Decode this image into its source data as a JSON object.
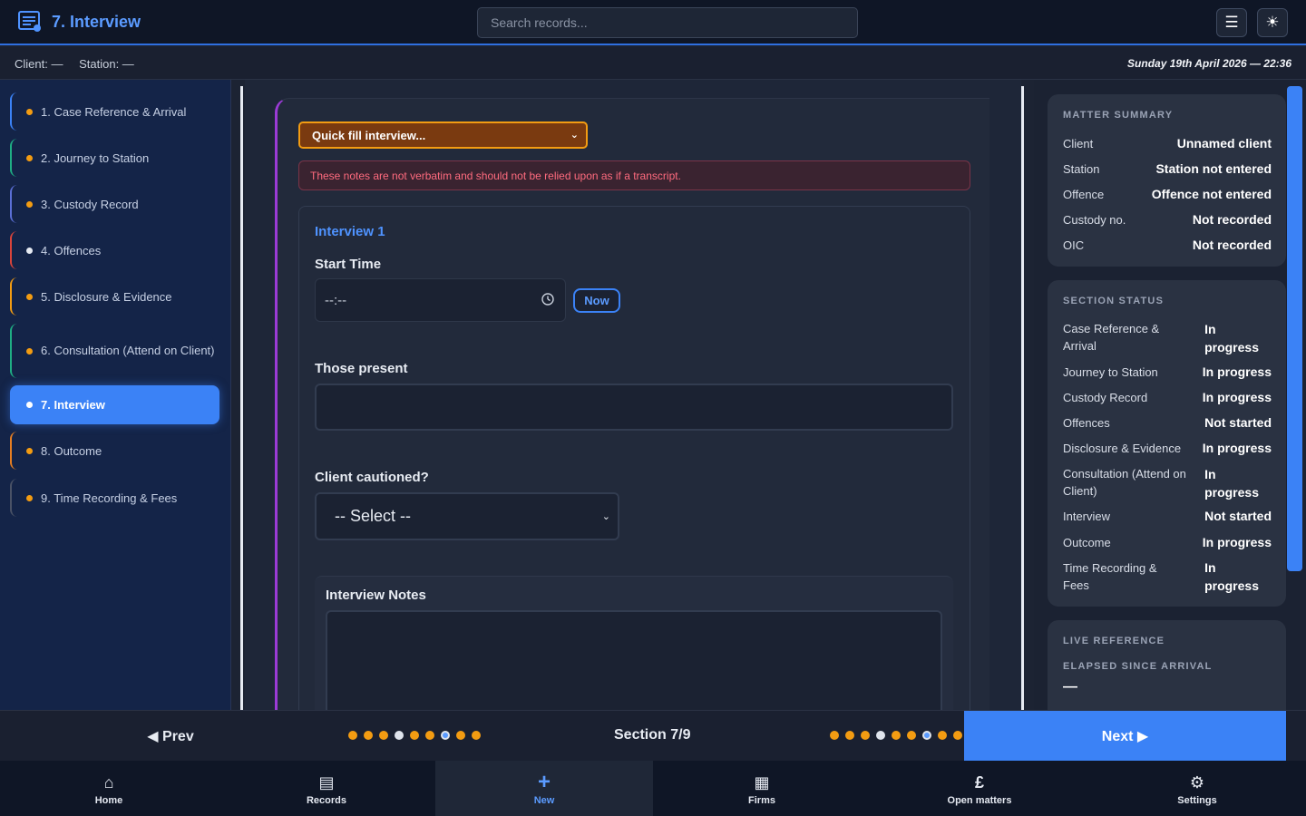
{
  "header": {
    "title": "7. Interview",
    "search_placeholder": "Search records...",
    "menu_icon": "hamburger-icon",
    "theme_icon": "sun-icon"
  },
  "subbar": {
    "client": "Client: —",
    "station": "Station: —",
    "datetime": "Sunday 19th April 2026 — 22:36"
  },
  "nav": {
    "items": [
      {
        "label": "1. Case Reference & Arrival",
        "status": "in-progress"
      },
      {
        "label": "2. Journey to Station",
        "status": "in-progress"
      },
      {
        "label": "3. Custody Record",
        "status": "in-progress"
      },
      {
        "label": "4. Offences",
        "status": "not-started"
      },
      {
        "label": "5. Disclosure & Evidence",
        "status": "in-progress"
      },
      {
        "label": "6. Consultation (Attend on Client)",
        "status": "in-progress"
      },
      {
        "label": "7. Interview",
        "status": "active"
      },
      {
        "label": "8. Outcome",
        "status": "in-progress"
      },
      {
        "label": "9. Time Recording & Fees",
        "status": "in-progress"
      }
    ]
  },
  "form": {
    "quickfill_label": "Quick fill interview...",
    "warning": "These notes are not verbatim and should not be relied upon as if a transcript.",
    "interview_heading": "Interview 1",
    "start_time_label": "Start Time",
    "start_time_value": "--:--",
    "now_button": "Now",
    "those_present_label": "Those present",
    "cautioned_label": "Client cautioned?",
    "cautioned_value": "-- Select --",
    "notes_label": "Interview Notes"
  },
  "summary": {
    "heading": "MATTER SUMMARY",
    "rows": [
      {
        "key": "Client",
        "value": "Unnamed client"
      },
      {
        "key": "Station",
        "value": "Station not entered"
      },
      {
        "key": "Offence",
        "value": "Offence not entered"
      },
      {
        "key": "Custody no.",
        "value": "Not recorded"
      },
      {
        "key": "OIC",
        "value": "Not recorded"
      }
    ]
  },
  "section_status": {
    "heading": "SECTION STATUS",
    "rows": [
      {
        "key1": "Case Reference &",
        "key2": "Arrival",
        "v1": "In",
        "v2": "progress"
      },
      {
        "key1": "Journey to Station",
        "v1": "In progress"
      },
      {
        "key1": "Custody Record",
        "v1": "In progress"
      },
      {
        "key1": "Offences",
        "v1": "Not started"
      },
      {
        "key1": "Disclosure & Evidence",
        "v1": "In progress"
      },
      {
        "key1": "Consultation (Attend on",
        "key2": "Client)",
        "v1": "In",
        "v2": "progress"
      },
      {
        "key1": "Interview",
        "v1": "Not started"
      },
      {
        "key1": "Outcome",
        "v1": "In progress"
      },
      {
        "key1": "Time Recording &",
        "key2": "Fees",
        "v1": "In",
        "v2": "progress"
      }
    ]
  },
  "live_reference": {
    "heading": "LIVE REFERENCE",
    "elapsed_label": "ELAPSED SINCE ARRIVAL",
    "elapsed_value": "—"
  },
  "section_nav": {
    "prev": "◀ Prev",
    "next": "Next ▶",
    "label": "Section 7/9",
    "current_index": 7,
    "total": 9
  },
  "tabs": [
    {
      "label": "Home",
      "icon": "home-icon",
      "glyph": "⌂"
    },
    {
      "label": "Records",
      "icon": "document-icon",
      "glyph": "▤"
    },
    {
      "label": "New",
      "icon": "plus-icon",
      "glyph": "+"
    },
    {
      "label": "Firms",
      "icon": "building-icon",
      "glyph": "▦"
    },
    {
      "label": "Open matters",
      "icon": "pound-icon",
      "glyph": "£"
    },
    {
      "label": "Settings",
      "icon": "gear-icon",
      "glyph": "⚙"
    }
  ],
  "colors": {
    "accent": "#3b82f6",
    "in_progress": "#f39c12",
    "interview_border": "#9b3bd6"
  }
}
